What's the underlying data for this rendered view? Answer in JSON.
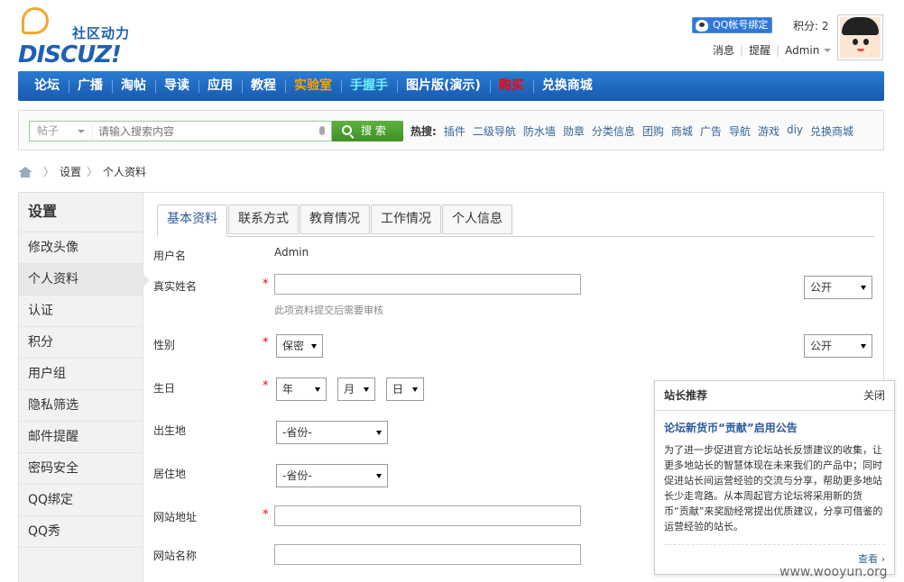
{
  "header": {
    "logo_sub": "社区动力",
    "logo_main": "DISCUZ!",
    "qq_bind_label": "QQ帐号绑定",
    "points": "积分: 2",
    "links": [
      "消息",
      "提醒",
      "Admin"
    ]
  },
  "nav": [
    "论坛",
    "广播",
    "淘帖",
    "导读",
    "应用",
    "教程",
    "实验室",
    "手握手",
    "图片版(演示)",
    "购买",
    "兑换商城"
  ],
  "nav_colors": {
    "实验室": "#ffa200",
    "手握手": "#6cf0ff",
    "购买": "#ff0000"
  },
  "search": {
    "type_label": "帖子",
    "placeholder": "请输入搜索内容",
    "button_label": "搜 索",
    "hot_label": "热搜:",
    "hot_keywords": [
      "插件",
      "二级导航",
      "防水墙",
      "勋章",
      "分类信息",
      "团购",
      "商城",
      "广告",
      "导航",
      "游戏",
      "diy",
      "兑换商城"
    ]
  },
  "breadcrumb": [
    "设置",
    "个人资料"
  ],
  "sidebar": {
    "title": "设置",
    "items": [
      "修改头像",
      "个人资料",
      "认证",
      "积分",
      "用户组",
      "隐私筛选",
      "邮件提醒",
      "密码安全",
      "QQ绑定",
      "QQ秀"
    ],
    "active": "个人资料"
  },
  "tabs": [
    "基本资料",
    "联系方式",
    "教育情况",
    "工作情况",
    "个人信息"
  ],
  "form": {
    "username_label": "用户名",
    "username_value": "Admin",
    "realname_label": "真实姓名",
    "realname_hint": "此项资料提交后需要审核",
    "gender_label": "性别",
    "gender_value": "保密",
    "birthday_label": "生日",
    "birthday_year": "年",
    "birthday_month": "月",
    "birthday_day": "日",
    "birthplace_label": "出生地",
    "residence_label": "居住地",
    "province_placeholder": "-省份-",
    "website_label": "网站地址",
    "sitename_label": "网站名称",
    "privacy_public": "公开",
    "required_mark": "*"
  },
  "recommend": {
    "header": "站长推荐",
    "close_label": "关闭",
    "title": "论坛新货币“贡献”启用公告",
    "body": "为了进一步促进官方论坛站长反馈建议的收集，让更多地站长的智慧体现在未来我们的产品中；同时促进站长间运营经验的交流与分享，帮助更多地站长少走弯路。从本周起官方论坛将采用新的货币“贡献”来奖励经常提出优质建议，分享可借鉴的运营经验的站长。",
    "more_label": "查看 ›"
  },
  "watermark": "www.wooyun.org"
}
